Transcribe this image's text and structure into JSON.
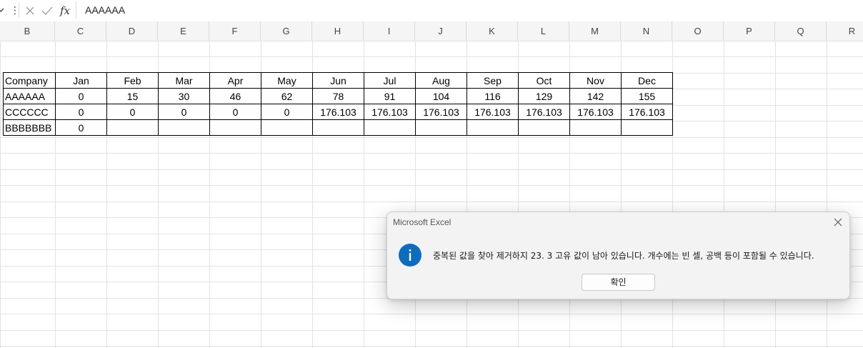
{
  "formula_bar": {
    "fx_label": "fx",
    "value": "AAAAAA"
  },
  "columns": [
    "B",
    "C",
    "D",
    "E",
    "F",
    "G",
    "H",
    "I",
    "J",
    "K",
    "L",
    "M",
    "N",
    "O",
    "P",
    "Q",
    "R"
  ],
  "table": {
    "header": [
      "Company",
      "Jan",
      "Feb",
      "Mar",
      "Apr",
      "May",
      "Jun",
      "Jul",
      "Aug",
      "Sep",
      "Oct",
      "Nov",
      "Dec"
    ],
    "rows": [
      [
        "AAAAAA",
        "0",
        "15",
        "30",
        "46",
        "62",
        "78",
        "91",
        "104",
        "116",
        "129",
        "142",
        "155"
      ],
      [
        "CCCCCC",
        "0",
        "0",
        "0",
        "0",
        "0",
        "176.103",
        "176.103",
        "176.103",
        "176.103",
        "176.103",
        "176.103",
        "176.103"
      ],
      [
        "BBBBBBB",
        "0",
        "",
        "",
        "",
        "",
        "",
        "",
        "",
        "",
        "",
        "",
        ""
      ]
    ]
  },
  "dialog": {
    "title": "Microsoft Excel",
    "message": "중복된 값을 찾아 제거하지 23. 3 고유 값이 남아 있습니다. 개수에는 빈 셀, 공백 등이 포함될 수 있습니다.",
    "ok_label": "확인",
    "icon": "info-icon",
    "accent_color": "#0f6cbd"
  }
}
